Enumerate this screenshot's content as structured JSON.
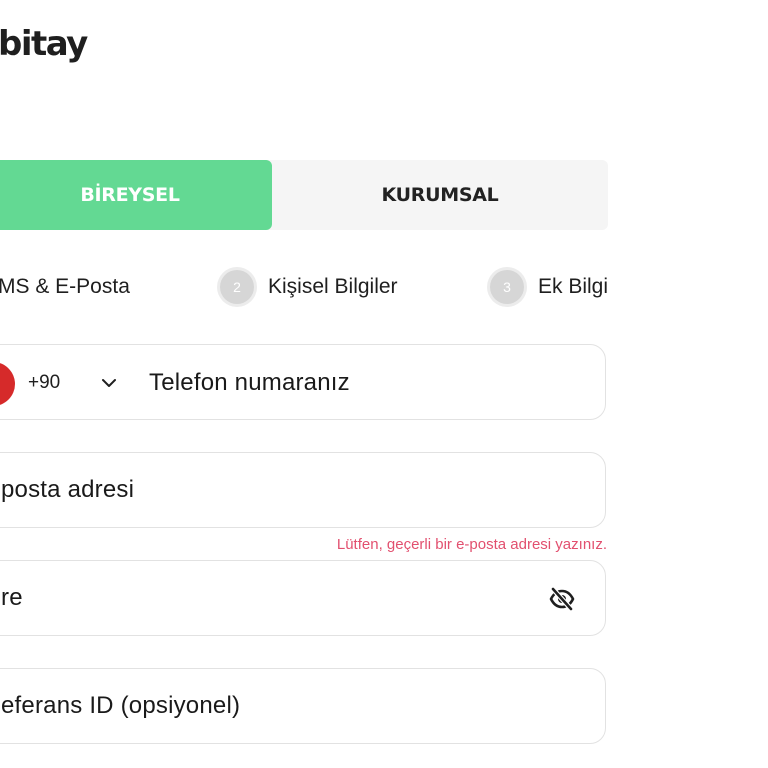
{
  "brand": {
    "logo_text": "bitay"
  },
  "tabs": [
    {
      "label": "BİREYSEL",
      "active": true
    },
    {
      "label": "KURUMSAL",
      "active": false
    }
  ],
  "steps": [
    {
      "number": "",
      "label": "MS & E-Posta"
    },
    {
      "number": "2",
      "label": "Kişisel Bilgiler"
    },
    {
      "number": "3",
      "label": "Ek Bilgi"
    }
  ],
  "phone": {
    "country_code": "+90",
    "placeholder": "Telefon numaranız",
    "flag_icon": "turkey-flag-icon"
  },
  "email": {
    "placeholder": "posta adresi",
    "error": "Lütfen, geçerli bir e-posta adresi yazınız."
  },
  "password": {
    "placeholder": "re",
    "toggle_icon": "eye-off-icon"
  },
  "referral": {
    "placeholder": "eferans ID (opsiyonel)"
  },
  "colors": {
    "accent": "#63d993",
    "error": "#e2506f",
    "tab_bg": "#f5f5f5",
    "step_circle": "#d6d6d6",
    "flag_red": "#d62a2a"
  }
}
